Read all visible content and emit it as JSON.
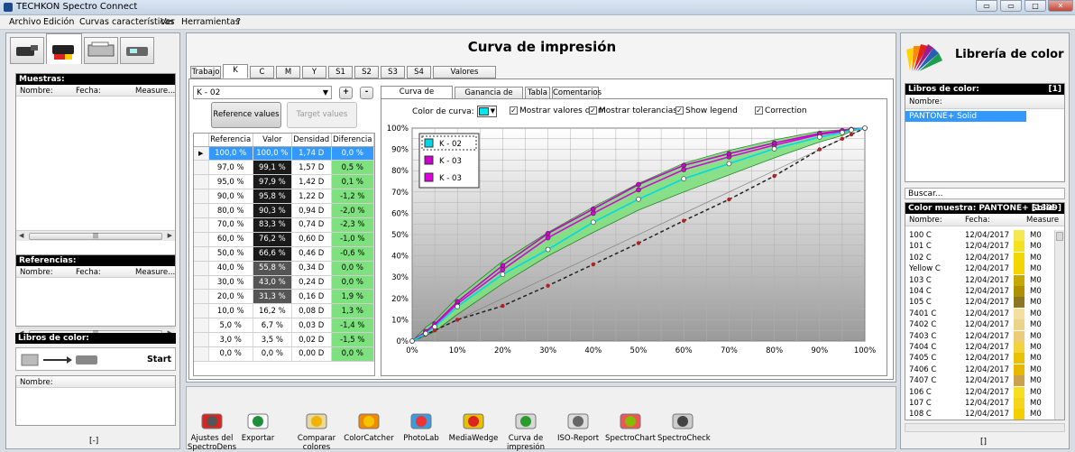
{
  "window": {
    "title": "TECHKON Spectro Connect"
  },
  "menu": [
    "Archivo",
    "Edición",
    "Curvas características",
    "Ver",
    "Herramientas",
    "?"
  ],
  "left": {
    "muestras": {
      "title": "Muestras:",
      "cols": [
        "Nombre:",
        "Fecha:",
        "Measure..."
      ]
    },
    "referencias": {
      "title": "Referencias:",
      "cols": [
        "Nombre:",
        "Fecha:",
        "Measure..."
      ]
    },
    "libros": {
      "title": "Libros de color:",
      "start": "Start",
      "col": "Nombre:",
      "footer": "[-]"
    }
  },
  "center": {
    "title": "Curva de impresión",
    "tabs": [
      "Trabajo",
      "K",
      "C",
      "M",
      "Y",
      "S1",
      "S2",
      "S3",
      "S4",
      "Valores promedio"
    ],
    "active_tab": "K",
    "curve_select": "K - 02",
    "plus": "+",
    "minus": "-",
    "ref_btn": "Reference values",
    "target_btn": "Target values",
    "table": {
      "headers": [
        "Referencia",
        "Valor",
        "Densidad",
        "Diferencia"
      ],
      "rows": [
        [
          "100,0 %",
          "100,0 %",
          "1,74 D",
          "0,0 %"
        ],
        [
          "97,0 %",
          "99,1 %",
          "1,57 D",
          "0,5 %"
        ],
        [
          "95,0 %",
          "97,9 %",
          "1,42 D",
          "0,1 %"
        ],
        [
          "90,0 %",
          "95,8 %",
          "1,22 D",
          "-1,2 %"
        ],
        [
          "80,0 %",
          "90,3 %",
          "0,94 D",
          "-2,0 %"
        ],
        [
          "70,0 %",
          "83,3 %",
          "0,74 D",
          "-2,3 %"
        ],
        [
          "60,0 %",
          "76,2 %",
          "0,60 D",
          "-1,0 %"
        ],
        [
          "50,0 %",
          "66,6 %",
          "0,46 D",
          "-0,6 %"
        ],
        [
          "40,0 %",
          "55,8 %",
          "0,34 D",
          "0,0 %"
        ],
        [
          "30,0 %",
          "43,0 %",
          "0,24 D",
          "0,0 %"
        ],
        [
          "20,0 %",
          "31,3 %",
          "0,16 D",
          "1,9 %"
        ],
        [
          "10,0 %",
          "16,2 %",
          "0,08 D",
          "1,3 %"
        ],
        [
          "5,0 %",
          "6,7 %",
          "0,03 D",
          "-1,4 %"
        ],
        [
          "3,0 %",
          "3,5 %",
          "0,02 D",
          "-1,5 %"
        ],
        [
          "0,0 %",
          "0,0 %",
          "0,00 D",
          "0,0 %"
        ]
      ]
    },
    "subtabs": [
      "Curva de impresión",
      "Ganancia de punto",
      "Tabla",
      "Comentarios"
    ],
    "options": {
      "color_label": "Color de curva:",
      "show_values": "Mostrar valores de m",
      "tolerances": "Mostrar tolerancias",
      "legend": "Show legend",
      "correction": "Correction"
    }
  },
  "chart_data": {
    "type": "line",
    "xlabel": "",
    "ylabel": "",
    "xlim": [
      0,
      100
    ],
    "ylim": [
      0,
      100
    ],
    "xticks": [
      "0%",
      "10%",
      "20%",
      "30%",
      "40%",
      "50%",
      "60%",
      "70%",
      "80%",
      "90%",
      "100%"
    ],
    "yticks": [
      "0%",
      "10%",
      "20%",
      "30%",
      "40%",
      "50%",
      "60%",
      "70%",
      "80%",
      "90%",
      "100%"
    ],
    "grid": true,
    "legend_position": "top-left",
    "x": [
      0,
      3,
      5,
      10,
      20,
      30,
      40,
      50,
      60,
      70,
      80,
      90,
      95,
      97,
      100
    ],
    "series": [
      {
        "name": "K - 02",
        "color": "#00d8e8",
        "values": [
          0,
          3.5,
          6.7,
          16.2,
          31.3,
          43.0,
          55.8,
          66.6,
          76.2,
          83.3,
          90.3,
          95.8,
          97.9,
          99.1,
          100
        ]
      },
      {
        "name": "K - 03",
        "color": "#cc00cc",
        "values": [
          0,
          4.5,
          8.0,
          18.5,
          35.5,
          50.5,
          62.0,
          73.5,
          82.5,
          88.0,
          93.0,
          97.5,
          98.8,
          99.4,
          100
        ]
      },
      {
        "name": "K - 03",
        "color": "#dd00dd",
        "values": [
          0,
          4.2,
          7.5,
          17.5,
          33.5,
          48.5,
          60.0,
          71.0,
          80.5,
          86.5,
          92.0,
          97.0,
          98.5,
          99.2,
          100
        ]
      }
    ],
    "reference": {
      "color": "#222222",
      "values": [
        0,
        3,
        5,
        10,
        16.5,
        26,
        36,
        46,
        56.5,
        66.5,
        77.5,
        90,
        95,
        97,
        100
      ]
    },
    "tolerance": {
      "upper": [
        0,
        6.5,
        9.5,
        20.5,
        37.5,
        51,
        63,
        74,
        83.5,
        89.5,
        94.5,
        98.5,
        99.2,
        99.6,
        100
      ],
      "lower": [
        0,
        2.5,
        4.5,
        12.5,
        27,
        40,
        51,
        61.5,
        70,
        78,
        86,
        93.5,
        96.5,
        98.5,
        100
      ]
    }
  },
  "right": {
    "title": "Librería de color",
    "libros_hdr": "Libros de color:",
    "libros_count": "[1]",
    "col": "Nombre:",
    "selected": "PANTONE+ Solid",
    "search": "Buscar...",
    "muestra_hdr": "Color muestra: PANTONE+ Solid",
    "muestra_count": "[1309]",
    "cols": [
      "Nombre:",
      "Fecha:",
      "Measure"
    ],
    "rows": [
      {
        "name": "100 C",
        "date": "12/04/2017",
        "color": "#f6e94f",
        "m": "M0"
      },
      {
        "name": "101 C",
        "date": "12/04/2017",
        "color": "#f4e11f",
        "m": "M0"
      },
      {
        "name": "102 C",
        "date": "12/04/2017",
        "color": "#f2d800",
        "m": "M0"
      },
      {
        "name": "Yellow C",
        "date": "12/04/2017",
        "color": "#f5d500",
        "m": "M0"
      },
      {
        "name": "103 C",
        "date": "12/04/2017",
        "color": "#c6a800",
        "m": "M0"
      },
      {
        "name": "104 C",
        "date": "12/04/2017",
        "color": "#ad9100",
        "m": "M0"
      },
      {
        "name": "105 C",
        "date": "12/04/2017",
        "color": "#8b7722",
        "m": "M0"
      },
      {
        "name": "7401 C",
        "date": "12/04/2017",
        "color": "#f5dfa0",
        "m": "M0"
      },
      {
        "name": "7402 C",
        "date": "12/04/2017",
        "color": "#ecd38a",
        "m": "M0"
      },
      {
        "name": "7403 C",
        "date": "12/04/2017",
        "color": "#eccb79",
        "m": "M0"
      },
      {
        "name": "7404 C",
        "date": "12/04/2017",
        "color": "#f3d33b",
        "m": "M0"
      },
      {
        "name": "7405 C",
        "date": "12/04/2017",
        "color": "#e8c200",
        "m": "M0"
      },
      {
        "name": "7406 C",
        "date": "12/04/2017",
        "color": "#e6b800",
        "m": "M0"
      },
      {
        "name": "7407 C",
        "date": "12/04/2017",
        "color": "#c9a14f",
        "m": "M0"
      },
      {
        "name": "106 C",
        "date": "12/04/2017",
        "color": "#f6df1e",
        "m": "M0"
      },
      {
        "name": "107 C",
        "date": "12/04/2017",
        "color": "#f4d51c",
        "m": "M0"
      },
      {
        "name": "108 C",
        "date": "12/04/2017",
        "color": "#f3cf00",
        "m": "M0"
      }
    ],
    "footer": "[]"
  },
  "toolbar": [
    {
      "label": "Ajustes del SpectroDens",
      "icon": "spectrodens-icon"
    },
    {
      "label": "Exportar",
      "icon": "export-excel-icon"
    },
    {
      "label": "Comparar colores",
      "icon": "compare-colors-icon"
    },
    {
      "label": "ColorCatcher",
      "icon": "colorcatcher-icon"
    },
    {
      "label": "PhotoLab",
      "icon": "photolab-icon"
    },
    {
      "label": "MediaWedge",
      "icon": "mediawedge-icon"
    },
    {
      "label": "Curva de impresión",
      "icon": "print-curve-icon"
    },
    {
      "label": "ISO-Report",
      "icon": "iso-report-icon"
    },
    {
      "label": "SpectroChart",
      "icon": "spectrochart-icon"
    },
    {
      "label": "SpectroCheck",
      "icon": "spectrocheck-icon"
    }
  ]
}
